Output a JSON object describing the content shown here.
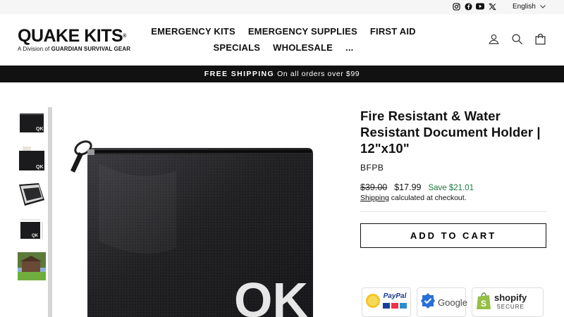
{
  "header": {
    "utility": {
      "social": [
        "instagram-icon",
        "facebook-icon",
        "youtube-icon",
        "x-icon"
      ],
      "language": "English"
    },
    "logo": {
      "main": "QUAKE KITS",
      "sub_prefix": "A Division of",
      "sub_brand": "GUARDIAN SURVIVAL GEAR"
    },
    "nav": [
      "EMERGENCY KITS",
      "EMERGENCY SUPPLIES",
      "FIRST AID",
      "SPECIALS",
      "WHOLESALE",
      "..."
    ],
    "icons": [
      "account-icon",
      "search-icon",
      "cart-icon"
    ]
  },
  "announcement": {
    "bold": "FREE SHIPPING",
    "text": "On all orders over $99"
  },
  "gallery": {
    "thumbnails": [
      "document-holder-front",
      "document-holder-with-papers",
      "document-holder-open",
      "document-holder-dimensions",
      "house-lifestyle"
    ],
    "main_logo": "QK"
  },
  "product": {
    "title": "Fire Resistant & Water Resistant Document Holder | 12\"x10\"",
    "sku": "BFPB",
    "compare_price": "$39.00",
    "price": "$17.99",
    "save": "Save $21.01",
    "shipping_link": "Shipping",
    "shipping_rest": " calculated at checkout.",
    "add_to_cart": "ADD TO CART"
  },
  "trust_badges": {
    "paypal": "PayPal",
    "google": "Google",
    "shopify": "shopify",
    "shopify_secure": "SECURE"
  },
  "colors": {
    "announce_bg": "#111111",
    "save_green": "#1c7a3f",
    "utility_bg": "#f6f6f6"
  }
}
